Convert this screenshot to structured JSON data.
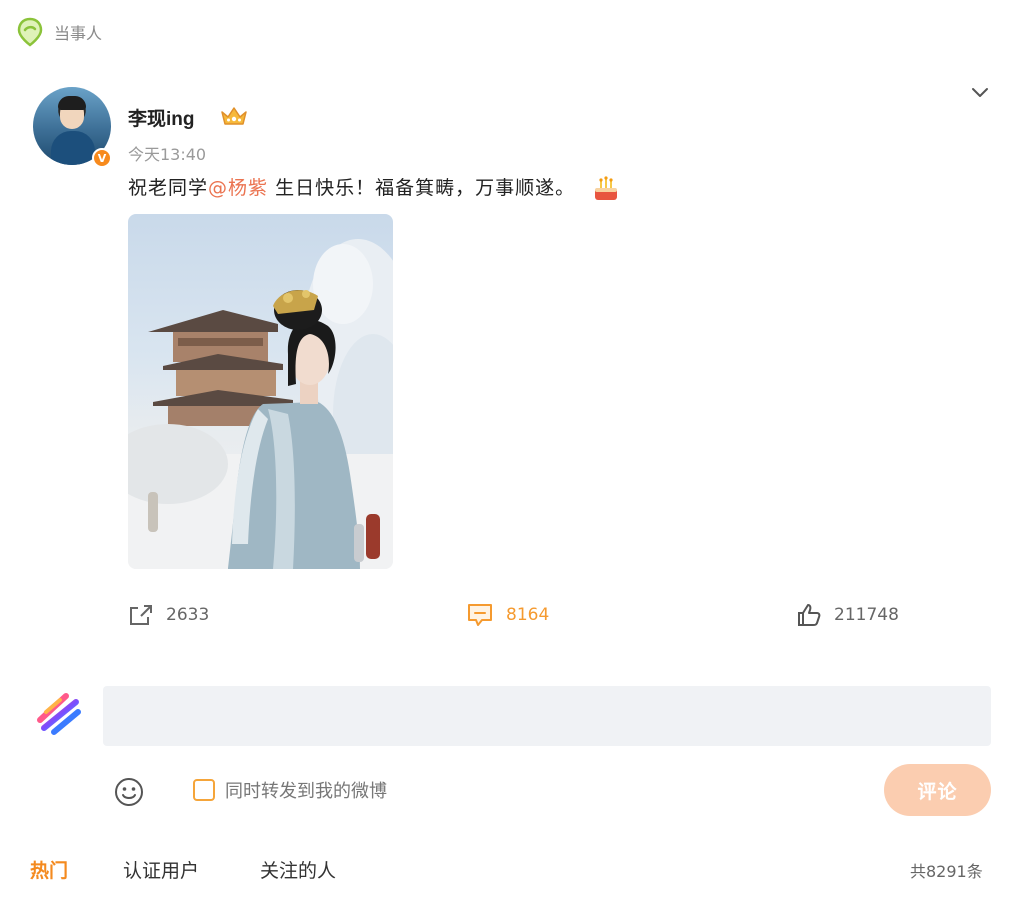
{
  "topbar": {
    "label": "当事人",
    "icon": "location-pin-icon"
  },
  "post": {
    "author": "李现ing",
    "time": "今天13:40",
    "text_prefix": "祝老同学",
    "mention": "@杨紫",
    "text_suffix": " 生日快乐！福备箕畴，万事顺遂。",
    "verified_badge": "V",
    "photo": {
      "description_icon": "photo"
    }
  },
  "actions": {
    "share_count": "2633",
    "comment_count": "8164",
    "like_count": "211748"
  },
  "composer": {
    "input_value": "",
    "repost_label": "同时转发到我的微博",
    "submit_label": "评论"
  },
  "tabs": [
    {
      "label": "热门",
      "active": true
    },
    {
      "label": "认证用户",
      "active": false
    },
    {
      "label": "关注的人",
      "active": false
    }
  ],
  "total_label": "共8291条",
  "colors": {
    "accent": "#f48a1f",
    "mention": "#eb7350",
    "submit_bg": "#fbcdb0",
    "input_bg": "#f0f2f5"
  }
}
